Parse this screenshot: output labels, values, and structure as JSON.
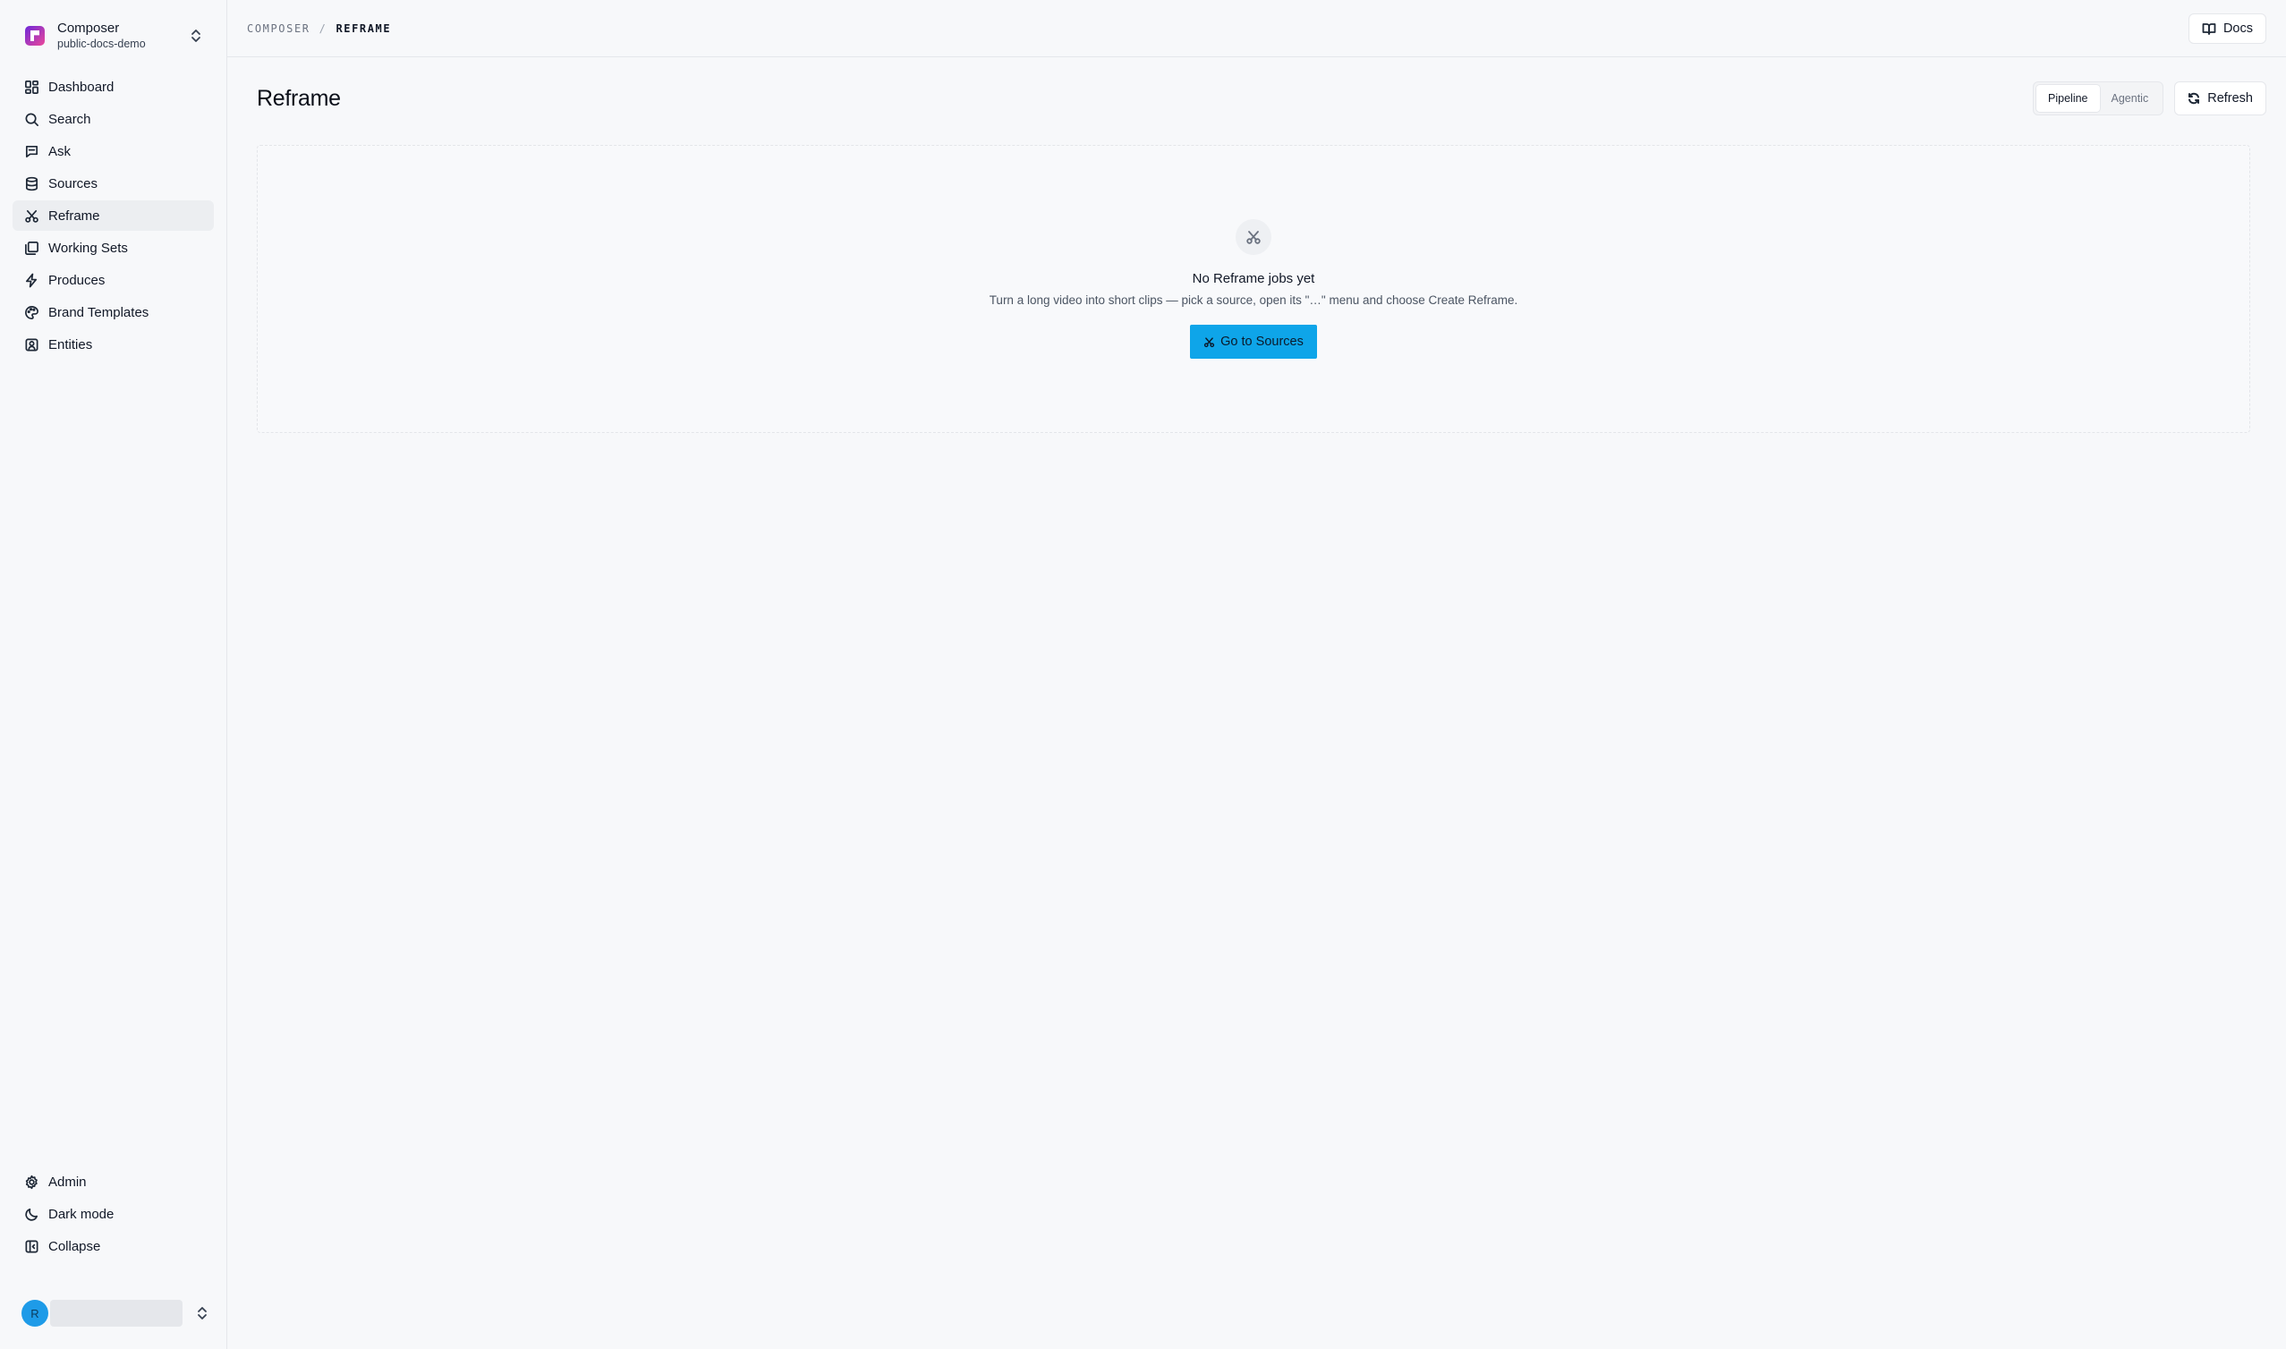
{
  "workspace": {
    "name": "Composer",
    "project": "public-docs-demo"
  },
  "nav": {
    "items": [
      {
        "label": "Dashboard",
        "icon": "dashboard-icon"
      },
      {
        "label": "Search",
        "icon": "search-icon"
      },
      {
        "label": "Ask",
        "icon": "chat-icon"
      },
      {
        "label": "Sources",
        "icon": "database-icon"
      },
      {
        "label": "Reframe",
        "icon": "scissors-icon",
        "active": true
      },
      {
        "label": "Working Sets",
        "icon": "layers-icon"
      },
      {
        "label": "Produces",
        "icon": "lightning-icon"
      },
      {
        "label": "Brand Templates",
        "icon": "palette-icon"
      },
      {
        "label": "Entities",
        "icon": "contact-icon"
      }
    ],
    "bottom": [
      {
        "label": "Admin",
        "icon": "gear-icon"
      },
      {
        "label": "Dark mode",
        "icon": "moon-icon"
      },
      {
        "label": "Collapse",
        "icon": "sidebar-collapse-icon"
      }
    ]
  },
  "user": {
    "initial": "R"
  },
  "breadcrumb": {
    "root": "COMPOSER",
    "separator": "/",
    "current": "REFRAME"
  },
  "header": {
    "docs_label": "Docs"
  },
  "page": {
    "title": "Reframe",
    "modes": [
      "Pipeline",
      "Agentic"
    ],
    "active_mode": "Pipeline",
    "refresh_label": "Refresh"
  },
  "empty_state": {
    "title": "No Reframe jobs yet",
    "description": "Turn a long video into short clips — pick a source, open its \"…\" menu and choose Create Reframe.",
    "cta_label": "Go to Sources"
  },
  "colors": {
    "accent": "#0ea5e9",
    "avatar": "#1e9be8"
  }
}
